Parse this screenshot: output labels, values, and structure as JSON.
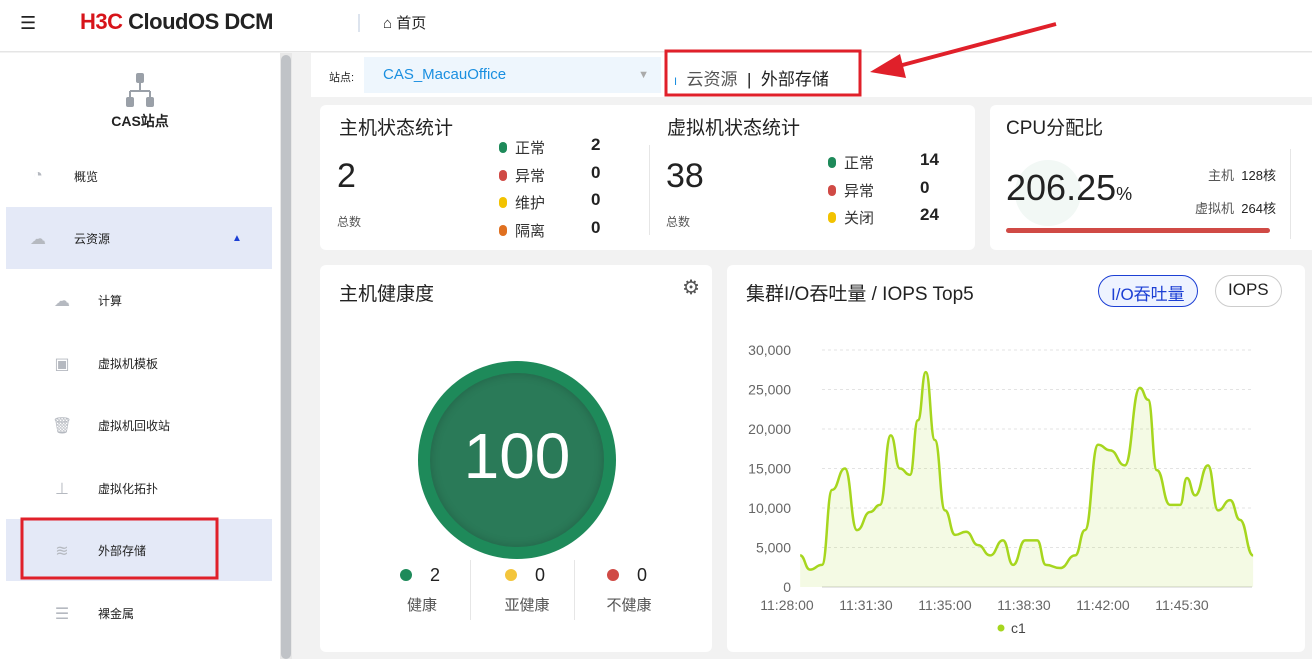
{
  "header": {
    "logo_brand": "H3C",
    "logo_product": "CloudOS DCM",
    "home_label": "首页"
  },
  "sidebar": {
    "site_title": "CAS站点",
    "items": [
      {
        "label": "概览",
        "icon": "gauge-icon"
      },
      {
        "label": "云资源",
        "icon": "cloud-icon",
        "expanded": true
      },
      {
        "label": "计算",
        "icon": "cloud-compute-icon"
      },
      {
        "label": "虚拟机模板",
        "icon": "template-icon"
      },
      {
        "label": "虚拟机回收站",
        "icon": "trash-icon"
      },
      {
        "label": "虚拟化拓扑",
        "icon": "topology-icon"
      },
      {
        "label": "外部存储",
        "icon": "database-icon",
        "selected": true
      },
      {
        "label": "裸金属",
        "icon": "server-icon"
      }
    ]
  },
  "site_bar": {
    "label": "站点:",
    "selected": "CAS_MacauOffice",
    "crumb_parent": "云资源",
    "crumb_sep": "|",
    "crumb_current": "外部存储"
  },
  "host_stats": {
    "title": "主机状态统计",
    "total": "2",
    "total_label": "总数",
    "legend": [
      {
        "label": "正常",
        "value": "2",
        "color": "#1e8a5a"
      },
      {
        "label": "异常",
        "value": "0",
        "color": "#d04a45"
      },
      {
        "label": "维护",
        "value": "0",
        "color": "#f2c200"
      },
      {
        "label": "隔离",
        "value": "0",
        "color": "#e07020"
      }
    ]
  },
  "vm_stats": {
    "title": "虚拟机状态统计",
    "total": "38",
    "total_label": "总数",
    "legend": [
      {
        "label": "正常",
        "value": "14",
        "color": "#1e8a5a"
      },
      {
        "label": "异常",
        "value": "0",
        "color": "#d04a45"
      },
      {
        "label": "关闭",
        "value": "24",
        "color": "#f2c200"
      }
    ]
  },
  "cpu": {
    "title": "CPU分配比",
    "value": "206.25",
    "unit": "%",
    "host_label": "主机",
    "host_value": "128核",
    "vm_label": "虚拟机",
    "vm_value": "264核",
    "bar_color": "#d04a45"
  },
  "health": {
    "title": "主机健康度",
    "score": "100",
    "legend": [
      {
        "value": "2",
        "label": "健康",
        "color": "#1e8a5a"
      },
      {
        "value": "0",
        "label": "亚健康",
        "color": "#f3c53c"
      },
      {
        "value": "0",
        "label": "不健康",
        "color": "#d04a45"
      }
    ]
  },
  "io": {
    "title": "集群I/O吞吐量 / IOPS Top5",
    "tab_throughput": "I/O吞吐量",
    "tab_iops": "IOPS"
  },
  "chart_data": {
    "type": "area",
    "title": "集群I/O吞吐量 / IOPS Top5",
    "ylim": [
      0,
      30000
    ],
    "yticks": [
      "0",
      "5,000",
      "10,000",
      "15,000",
      "20,000",
      "25,000",
      "30,000"
    ],
    "xticks": [
      "11:28:00",
      "11:31:30",
      "11:35:00",
      "11:38:30",
      "11:42:00",
      "11:45:30"
    ],
    "x_unit": "seconds since 11:28:00",
    "series": [
      {
        "name": "c1",
        "color": "#a6d61e",
        "x": [
          35,
          61,
          93,
          120,
          154,
          186,
          221,
          247,
          276,
          300,
          327,
          348,
          369,
          393,
          420,
          447,
          476,
          508,
          540,
          574,
          601,
          633,
          665,
          688,
          726,
          766,
          792,
          827,
          859,
          898,
          938,
          960,
          983,
          1018,
          1045,
          1063,
          1085,
          1119,
          1146,
          1178,
          1204,
          1239
        ],
        "y": [
          4000,
          2200,
          2800,
          12300,
          15000,
          7200,
          9500,
          10400,
          19200,
          15000,
          14200,
          21100,
          27200,
          18600,
          9700,
          6600,
          7000,
          5300,
          4000,
          5900,
          2800,
          5900,
          5900,
          2800,
          2400,
          4000,
          7200,
          18000,
          17300,
          15400,
          25200,
          23700,
          14800,
          10400,
          10400,
          13800,
          11600,
          15400,
          9700,
          11000,
          8500,
          4000
        ]
      }
    ]
  }
}
